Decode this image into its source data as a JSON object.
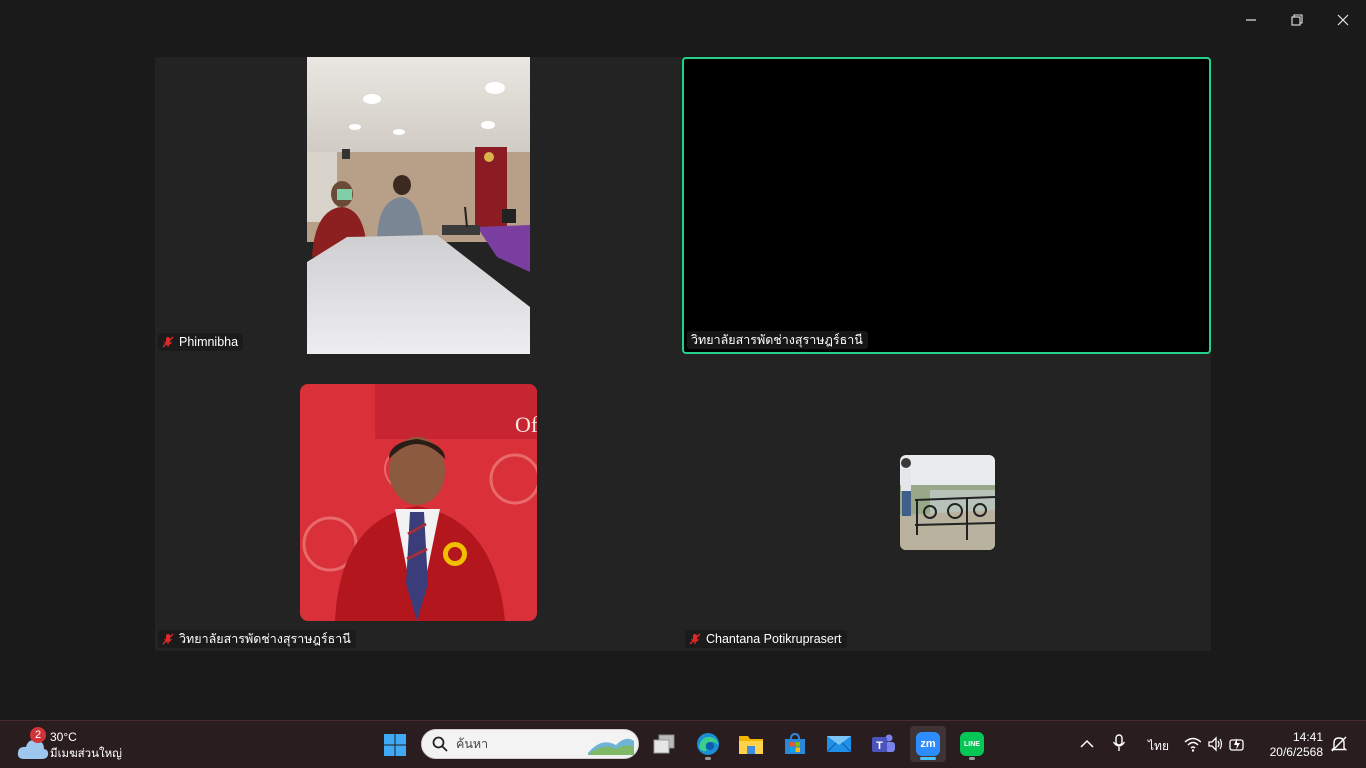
{
  "window": {
    "controls": {
      "minimize": "minimize",
      "restore": "restore",
      "close": "close"
    }
  },
  "participants": [
    {
      "name": "Phimnibha",
      "muted": true,
      "video": "photo-meeting-room"
    },
    {
      "name": "วิทยาลัยสารพัดช่างสุราษฎร์ธานี",
      "muted": false,
      "active_speaker": true,
      "video": "off"
    },
    {
      "name": "วิทยาลัยสารพัดช่างสุราษฎร์ธานี",
      "muted": true,
      "video": "profile-photo-man-red-jacket",
      "photo_text": "Of"
    },
    {
      "name": "Chantana Potikruprasert",
      "muted": true,
      "video": "profile-photo-scenic-railing"
    }
  ],
  "taskbar": {
    "weather": {
      "badge": "2",
      "temp": "30°C",
      "condition": "มีเมฆส่วนใหญ่",
      "icon": "cloud-icon"
    },
    "search_placeholder": "ค้นหา",
    "apps": [
      "windows-start",
      "task-view",
      "edge",
      "file-explorer",
      "microsoft-store",
      "mail",
      "teams",
      "zoom",
      "line"
    ],
    "active_app": "zoom",
    "zoom_label": "zm",
    "line_label": "LINE",
    "tray": {
      "language": "ไทย",
      "time": "14:41",
      "date": "20/6/2568"
    }
  },
  "colors": {
    "active_border": "#23d18b",
    "mute_red": "#e02828",
    "background": "#1a1a1a",
    "tile": "#232323"
  }
}
